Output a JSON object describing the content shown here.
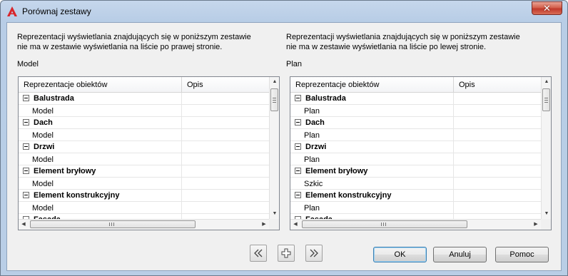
{
  "window": {
    "title": "Porównaj zestawy",
    "close_label": "✕"
  },
  "left_panel": {
    "description": "Reprezentacji wyświetlania znajdujących się w poniższym zestawie\nnie ma w zestawie wyświetlania na liście po prawej stronie.",
    "set_name": "Model",
    "columns": [
      "Reprezentacje obiektów",
      "Opis"
    ],
    "rows": [
      {
        "type": "group",
        "label": "Balustrada"
      },
      {
        "type": "item",
        "label": "Model"
      },
      {
        "type": "group",
        "label": "Dach"
      },
      {
        "type": "item",
        "label": "Model"
      },
      {
        "type": "group",
        "label": "Drzwi"
      },
      {
        "type": "item",
        "label": "Model"
      },
      {
        "type": "group",
        "label": "Element bryłowy"
      },
      {
        "type": "item",
        "label": "Model"
      },
      {
        "type": "group",
        "label": "Element konstrukcyjny"
      },
      {
        "type": "item",
        "label": "Model"
      },
      {
        "type": "group",
        "label": "Fasada"
      }
    ]
  },
  "right_panel": {
    "description": "Reprezentacji wyświetlania znajdujących się w poniższym zestawie\nnie ma w zestawie wyświetlania na liście po lewej stronie.",
    "set_name": "Plan",
    "columns": [
      "Reprezentacje obiektów",
      "Opis"
    ],
    "rows": [
      {
        "type": "group",
        "label": "Balustrada"
      },
      {
        "type": "item",
        "label": "Plan"
      },
      {
        "type": "group",
        "label": "Dach"
      },
      {
        "type": "item",
        "label": "Plan"
      },
      {
        "type": "group",
        "label": "Drzwi"
      },
      {
        "type": "item",
        "label": "Plan"
      },
      {
        "type": "group",
        "label": "Element bryłowy"
      },
      {
        "type": "item",
        "label": "Szkic"
      },
      {
        "type": "group",
        "label": "Element konstrukcyjny"
      },
      {
        "type": "item",
        "label": "Plan"
      },
      {
        "type": "group",
        "label": "Fasada"
      }
    ]
  },
  "toolbar": {
    "copy_left_icon": "double-chevron-left-icon",
    "add_icon": "plus-icon",
    "copy_right_icon": "double-chevron-right-icon"
  },
  "buttons": {
    "ok": "OK",
    "cancel": "Anuluj",
    "help": "Pomoc"
  },
  "colors": {
    "title_gradient": "#b9cee6",
    "close_red": "#c0392b",
    "logo_red": "#d8262b"
  }
}
